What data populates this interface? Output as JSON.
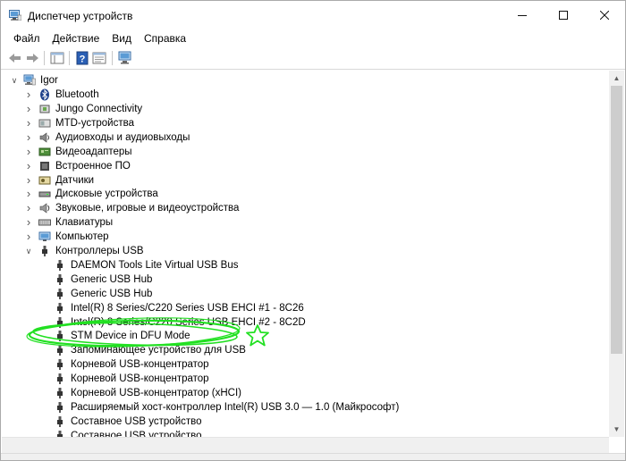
{
  "window": {
    "title": "Диспетчер устройств",
    "minimize_glyph": "—",
    "maximize_glyph": "☐",
    "close_glyph": "✕"
  },
  "menu": [
    "Файл",
    "Действие",
    "Вид",
    "Справка"
  ],
  "tree": {
    "root": {
      "label": "Igor",
      "icon": "computer-icon"
    },
    "categories": [
      {
        "label": "Bluetooth",
        "icon": "bluetooth-icon"
      },
      {
        "label": "Jungo Connectivity",
        "icon": "usb-device-icon"
      },
      {
        "label": "MTD-устройства",
        "icon": "mtd-device-icon"
      },
      {
        "label": "Аудиовходы и аудиовыходы",
        "icon": "speaker-icon"
      },
      {
        "label": "Видеоадаптеры",
        "icon": "display-adapter-icon"
      },
      {
        "label": "Встроенное ПО",
        "icon": "firmware-icon"
      },
      {
        "label": "Датчики",
        "icon": "sensor-icon"
      },
      {
        "label": "Дисковые устройства",
        "icon": "disk-drive-icon"
      },
      {
        "label": "Звуковые, игровые и видеоустройства",
        "icon": "sound-icon"
      },
      {
        "label": "Клавиатуры",
        "icon": "keyboard-icon"
      },
      {
        "label": "Компьютер",
        "icon": "monitor-icon"
      },
      {
        "label": "Контроллеры USB",
        "icon": "usb-controller-icon"
      }
    ],
    "usb_children": [
      "DAEMON Tools Lite Virtual USB Bus",
      "Generic USB Hub",
      "Generic USB Hub",
      "Intel(R) 8 Series/C220 Series USB EHCI #1 - 8C26",
      "Intel(R) 8 Series/C220 Series USB EHCI #2 - 8C2D",
      "STM Device in DFU Mode",
      "Запоминающее устройство для USB",
      "Корневой USB-концентратор",
      "Корневой USB-концентратор",
      "Корневой USB-концентратор (xHCI)",
      "Расширяемый хост-контроллер Intel(R) USB 3.0 — 1.0 (Майкрософт)",
      "Составное USB устройство",
      "Составное USB устройство"
    ],
    "highlighted_item": "STM Device in DFU Mode"
  },
  "colors": {
    "annotation": "#22e022",
    "accent": "#1e6fd0"
  }
}
